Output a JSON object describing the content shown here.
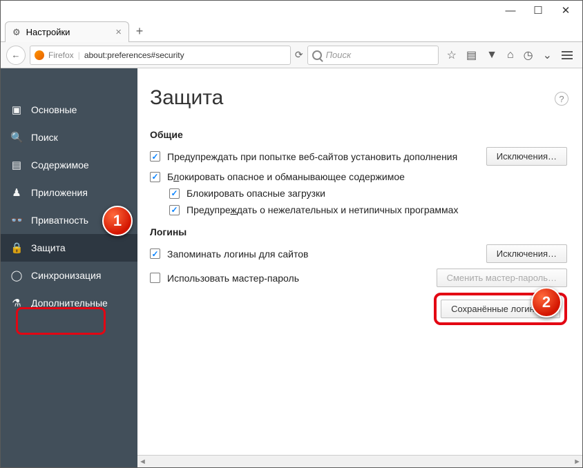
{
  "window": {
    "min": "—",
    "max": "☐",
    "close": "✕"
  },
  "tab": {
    "title": "Настройки",
    "close": "×",
    "new": "+"
  },
  "urlbar": {
    "brand": "Firefox",
    "url": "about:preferences#security",
    "reload": "⟳"
  },
  "searchbar": {
    "placeholder": "Поиск"
  },
  "toolbar_icons": {
    "star": "☆",
    "clipboard": "▤",
    "download": "▼",
    "home": "⌂",
    "sync": "◷",
    "pocket": "⌄"
  },
  "sidebar": {
    "items": [
      {
        "icon": "▣",
        "label": "Основные"
      },
      {
        "icon": "🔍",
        "label": "Поиск"
      },
      {
        "icon": "▤",
        "label": "Содержимое"
      },
      {
        "icon": "♟",
        "label": "Приложения"
      },
      {
        "icon": "👓",
        "label": "Приватность"
      },
      {
        "icon": "🔒",
        "label": "Защита"
      },
      {
        "icon": "◯",
        "label": "Синхронизация"
      },
      {
        "icon": "⚗",
        "label": "Дополнительные"
      }
    ]
  },
  "page": {
    "title": "Защита",
    "help": "?",
    "section_general": "Общие",
    "warn_install": "Предупреждать при попытке веб-сайтов установить дополнения",
    "exclusions": "Исключения…",
    "block_dangerous_pre": "Б",
    "block_dangerous_hot": "л",
    "block_dangerous_post": "окировать опасное и обманывающее содержимое",
    "block_downloads": "Блокировать опасные загрузки",
    "warn_unwanted_pre": "Предупре",
    "warn_unwanted_hot": "ж",
    "warn_unwanted_post": "дать о нежелательных и нетипичных программах",
    "section_logins": "Логины",
    "remember_logins": "Запоминать логины для сайтов",
    "exclusions2": "Исключения…",
    "use_master": "Использовать мастер-пароль",
    "change_master": "Сменить мастер-пароль…",
    "saved_logins": "Сохранённые логины…"
  },
  "badges": {
    "one": "1",
    "two": "2"
  }
}
